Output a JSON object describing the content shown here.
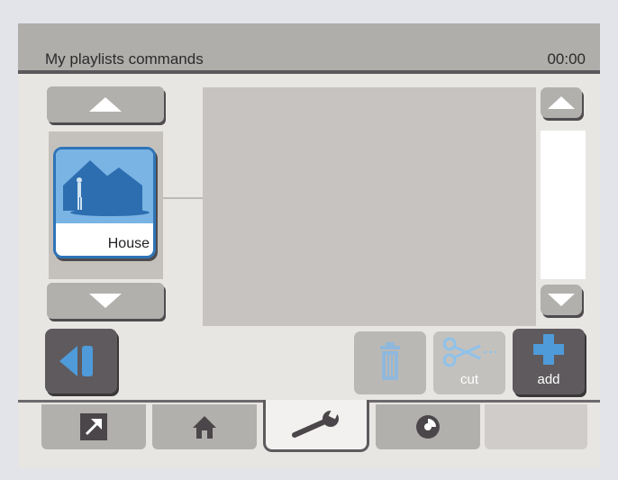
{
  "header": {
    "title": "My playlists commands",
    "time": "00:00"
  },
  "playlist": {
    "items": [
      {
        "label": "House",
        "icon": "house-icon"
      }
    ]
  },
  "actions": {
    "delete_icon": "trash-icon",
    "cut_label": "cut",
    "add_label": "add"
  },
  "nav": {
    "back_icon": "back-icon"
  },
  "tabs": [
    {
      "icon": "shortcut-arrow-icon"
    },
    {
      "icon": "home-icon"
    },
    {
      "icon": "wrench-icon",
      "active": true
    },
    {
      "icon": "disc-icon"
    },
    {
      "icon": ""
    }
  ],
  "colors": {
    "accent": "#2f74b8",
    "tile_bg": "#79b4e4",
    "dark_button": "#5e5a5d",
    "light_button": "#b2b0ad"
  }
}
